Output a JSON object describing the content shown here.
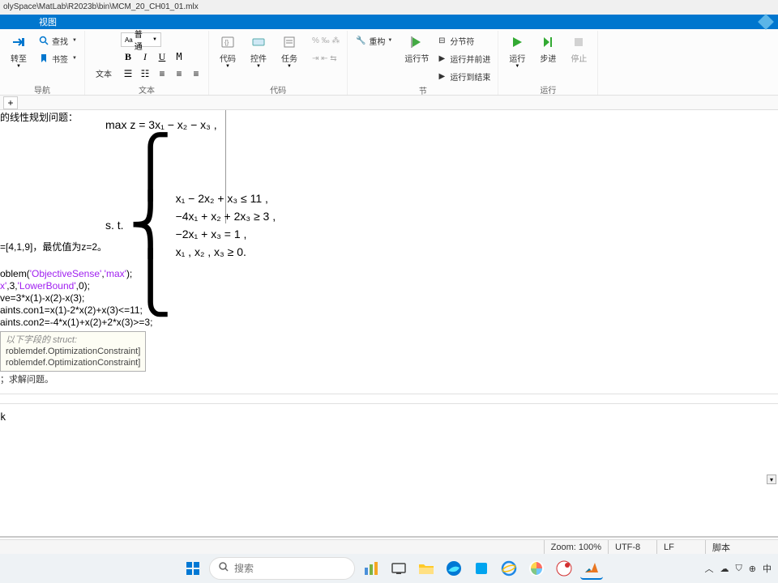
{
  "window": {
    "title": "olySpace\\MatLab\\R2023b\\bin\\MCM_20_CH01_01.mlx"
  },
  "ribbon": {
    "active_tab": "视图",
    "groups": {
      "nav": {
        "goto": "转至",
        "find": "查找",
        "bookmark": "书签",
        "label": "导航"
      },
      "text": {
        "style_normal": "普通",
        "aa": "Aa",
        "btn_text": "文本",
        "label": "文本"
      },
      "code": {
        "btn_code": "代码",
        "btn_control": "控件",
        "btn_task": "任务",
        "label": "代码"
      },
      "section": {
        "refactor": "重构",
        "btn_runsection": "运行节",
        "split": "分节符",
        "run_advance": "运行并前进",
        "run_to_end": "运行到结束",
        "label": "节"
      },
      "run": {
        "run": "运行",
        "step": "步进",
        "stop": "停止",
        "label": "运行"
      }
    }
  },
  "doc_tabs": {
    "plus": "+"
  },
  "editor": {
    "header_fragment": "的线性规划问题：",
    "equations": {
      "objective": "max z = 3x₁ − x₂ − x₃ ,",
      "st": "s. t.",
      "c1": "x₁ − 2x₂ + x₃ ≤ 11 ,",
      "c2": "−4x₁ + x₂ + 2x₃ ≥ 3 ,",
      "c3": "−2x₁ + x₃ = 1 ,",
      "c4": "x₁ , x₂ , x₃ ≥ 0."
    },
    "result": "=[4,1,9]，最优值为z=2。",
    "code": {
      "l1a": "oblem(",
      "l1s1": "'ObjectiveSense'",
      "l1b": ",",
      "l1s2": "'max'",
      "l1c": ");",
      "l2a": "x'",
      "l2b": ",3,",
      "l2s": "'LowerBound'",
      "l2c": ",0);",
      "l3": "ve=3*x(1)-x(2)-x(3);",
      "l4": "aints.con1=x(1)-2*x(2)+x(3)<=11;",
      "l5": "aints.con2=-4*x(1)+x(2)+2*x(3)>=3;"
    },
    "tooltip": {
      "header": "以下字段的 struct:",
      "line1": "roblemdef.OptimizationConstraint]",
      "line2": "roblemdef.OptimizationConstraint]"
    },
    "below_text": "；求解问题。",
    "output_k": "k"
  },
  "statusbar": {
    "zoom": "Zoom: 100%",
    "encoding": "UTF-8",
    "eol": "LF",
    "mode": "脚本"
  },
  "taskbar": {
    "search_placeholder": "搜索",
    "tray_more": "中"
  }
}
